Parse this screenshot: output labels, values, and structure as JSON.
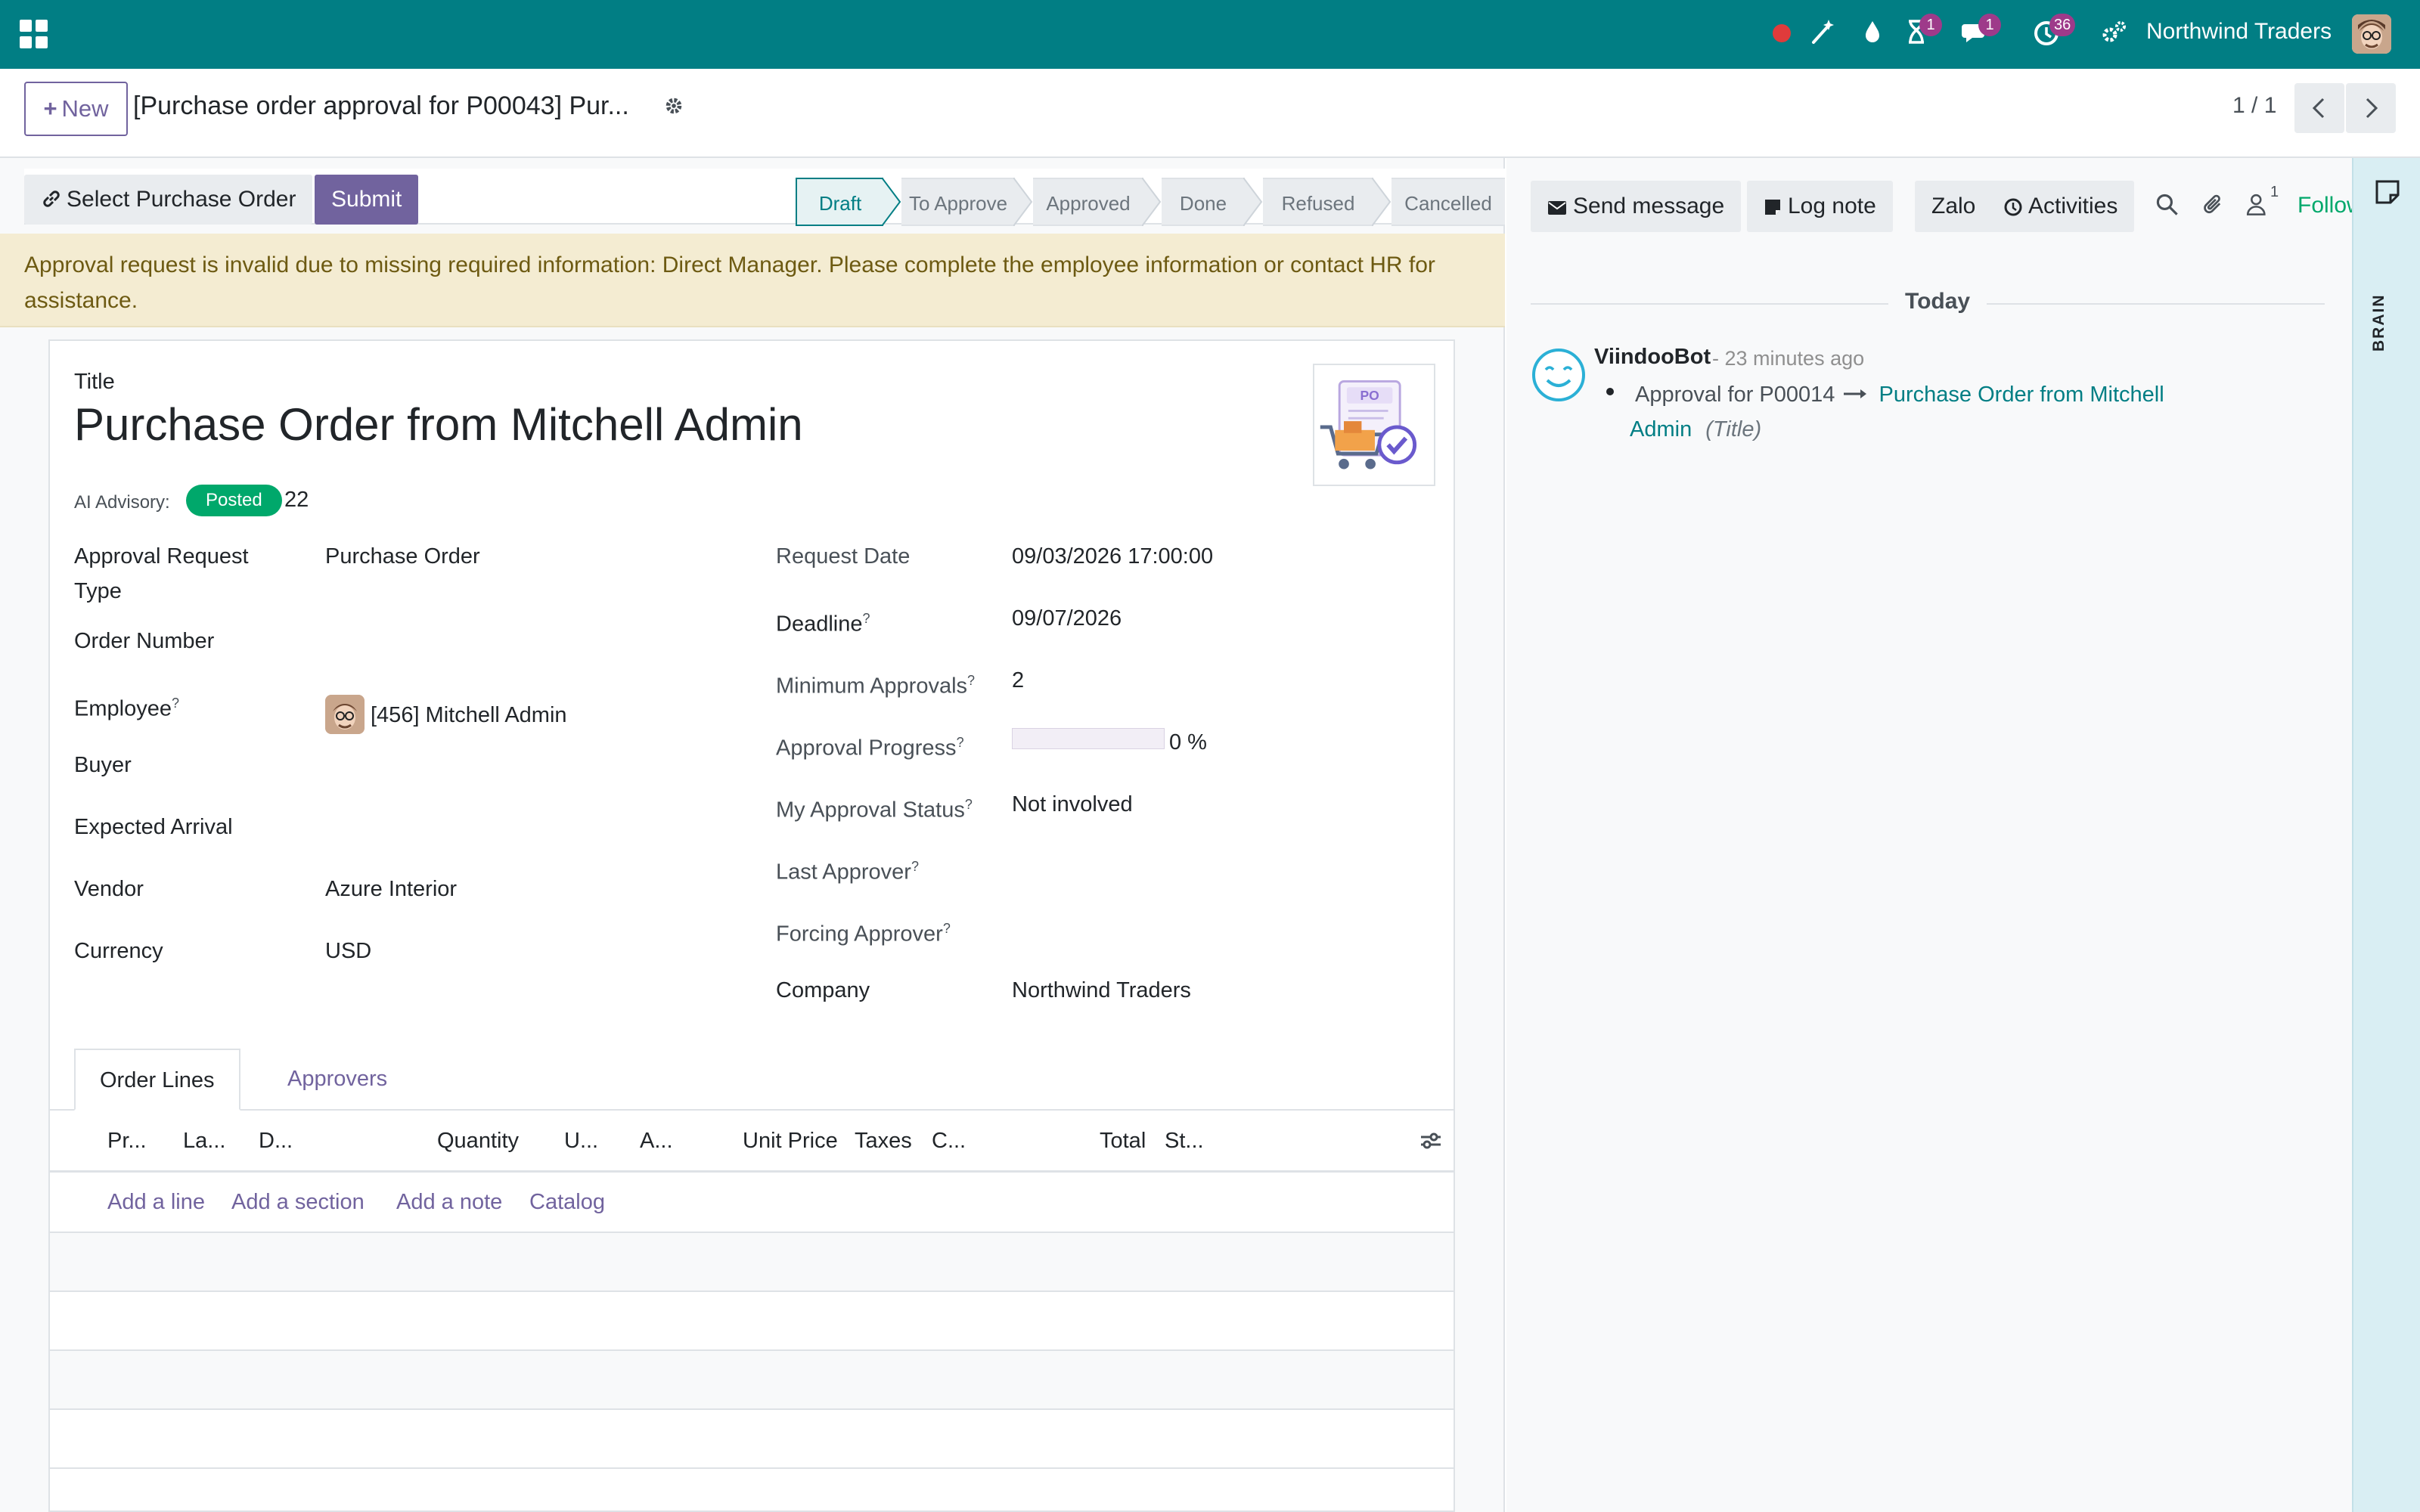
{
  "navbar": {
    "company": "Northwind Traders",
    "badges": {
      "activity": "1",
      "messages": "1",
      "clock": "36"
    },
    "accent_color": "#017e84"
  },
  "control_panel": {
    "new_label": "New",
    "breadcrumb": "[Purchase order approval for P00043] Pur...",
    "pager": "1 / 1"
  },
  "statusbar": {
    "select_label": "Select Purchase Order",
    "submit_label": "Submit",
    "stages": [
      "Draft",
      "To Approve",
      "Approved",
      "Done",
      "Refused",
      "Cancelled"
    ],
    "active_stage": "Draft"
  },
  "warning": "Approval request is invalid due to missing required information: Direct Manager. Please complete the employee information or contact HR for assistance.",
  "form": {
    "title_label": "Title",
    "title": "Purchase Order from Mitchell Admin",
    "image_label": "PO",
    "ai_label": "AI Advisory:",
    "ai_badge": "Posted",
    "ai_value": "22",
    "left": {
      "approval_type_label": "Approval Request Type",
      "approval_type": "Purchase Order",
      "order_number_label": "Order Number",
      "employee_label": "Employee",
      "employee": "[456] Mitchell Admin",
      "buyer_label": "Buyer",
      "expected_arrival_label": "Expected Arrival",
      "vendor_label": "Vendor",
      "vendor": "Azure Interior",
      "currency_label": "Currency",
      "currency": "USD"
    },
    "right": {
      "request_date_label": "Request Date",
      "request_date": "09/03/2026 17:00:00",
      "deadline_label": "Deadline",
      "deadline": "09/07/2026",
      "min_approvals_label": "Minimum Approvals",
      "min_approvals": "2",
      "progress_label": "Approval Progress",
      "progress": "0 %",
      "progress_fraction": 0,
      "my_status_label": "My Approval Status",
      "my_status": "Not involved",
      "last_approver_label": "Last Approver",
      "forcing_approver_label": "Forcing Approver",
      "company_label": "Company",
      "company": "Northwind Traders"
    },
    "help_mark": "?",
    "tabs": [
      "Order Lines",
      "Approvers"
    ],
    "columns": [
      "Pr...",
      "La...",
      "D...",
      "Quantity",
      "U...",
      "A...",
      "Unit Price",
      "Taxes",
      "C...",
      "Total",
      "St..."
    ],
    "add_links": [
      "Add a line",
      "Add a section",
      "Add a note",
      "Catalog"
    ]
  },
  "chatter": {
    "send_message": "Send message",
    "log_note": "Log note",
    "zalo": "Zalo",
    "activities": "Activities",
    "followers_count": "1",
    "follow": "Follow",
    "today": "Today",
    "message": {
      "author": "ViindooBot",
      "time": "- 23 minutes ago",
      "old_value": "Approval for P00014",
      "new_value_part1": "Purchase Order from Mitchell",
      "new_value_part2": "Admin",
      "field": "(Title)"
    }
  },
  "brain": {
    "label": "BRAIN"
  }
}
